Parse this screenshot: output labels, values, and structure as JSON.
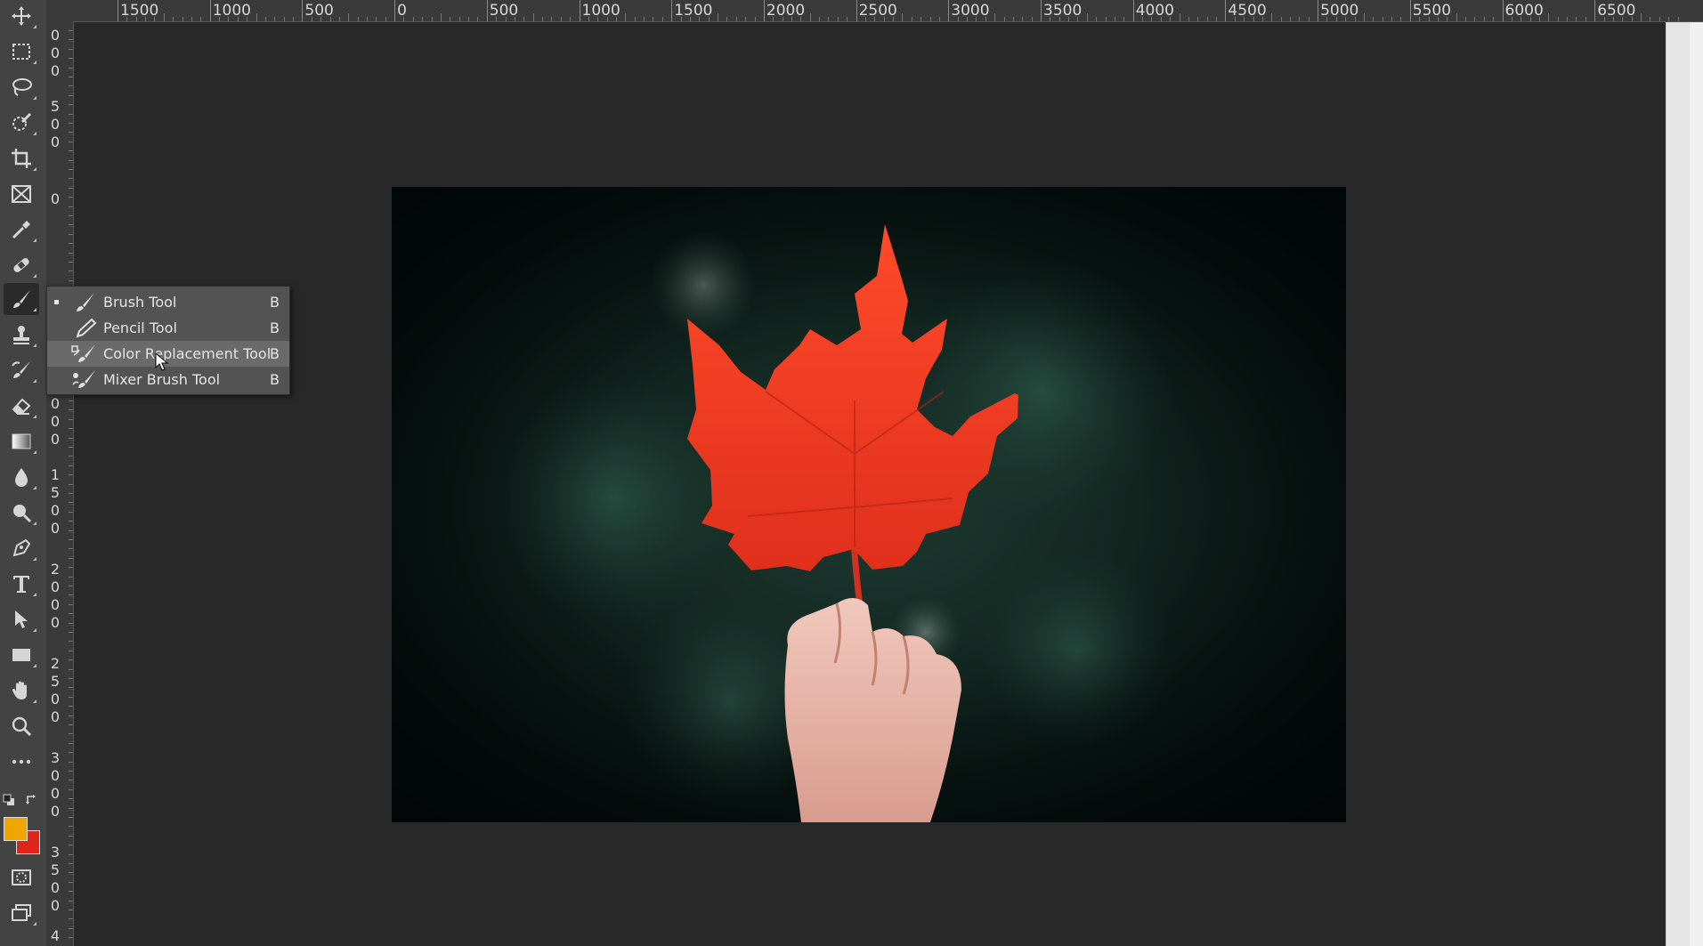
{
  "ruler_top": {
    "labels": [
      "1500",
      "1000",
      "500",
      "0",
      "500",
      "1000",
      "1500",
      "2000",
      "2500",
      "3000",
      "3500",
      "4000",
      "4500",
      "5000",
      "5500",
      "6000",
      "6500"
    ]
  },
  "ruler_left": {
    "labels": [
      "0\n0\n0",
      "5\n0\n0",
      "0",
      "0\n0\n0",
      "1\n5\n0\n0",
      "2\n0\n0\n0",
      "2\n5\n0\n0",
      "3\n0\n0\n0",
      "3\n5\n0\n0",
      "4"
    ]
  },
  "toolbar": {
    "tools": [
      {
        "name": "move-tool",
        "icon": "move-icon"
      },
      {
        "name": "rectangular-marquee-tool",
        "icon": "marquee-icon"
      },
      {
        "name": "lasso-tool",
        "icon": "lasso-icon"
      },
      {
        "name": "quick-selection-tool",
        "icon": "quick-selection-icon"
      },
      {
        "name": "crop-tool",
        "icon": "crop-icon"
      },
      {
        "name": "frame-tool",
        "icon": "frame-icon"
      },
      {
        "name": "eyedropper-tool",
        "icon": "eyedropper-icon"
      },
      {
        "name": "healing-brush-tool",
        "icon": "bandage-icon"
      },
      {
        "name": "brush-tool",
        "icon": "brush-icon",
        "active": true
      },
      {
        "name": "clone-stamp-tool",
        "icon": "stamp-icon"
      },
      {
        "name": "history-brush-tool",
        "icon": "history-brush-icon"
      },
      {
        "name": "eraser-tool",
        "icon": "eraser-icon"
      },
      {
        "name": "gradient-tool",
        "icon": "gradient-icon"
      },
      {
        "name": "blur-tool",
        "icon": "drop-icon"
      },
      {
        "name": "dodge-tool",
        "icon": "dodge-icon"
      },
      {
        "name": "pen-tool",
        "icon": "pen-icon"
      },
      {
        "name": "type-tool",
        "icon": "type-icon"
      },
      {
        "name": "path-selection-tool",
        "icon": "arrow-icon"
      },
      {
        "name": "rectangle-tool",
        "icon": "rectangle-icon"
      },
      {
        "name": "hand-tool",
        "icon": "hand-icon"
      },
      {
        "name": "zoom-tool",
        "icon": "zoom-icon"
      },
      {
        "name": "edit-toolbar",
        "icon": "more-icon"
      }
    ],
    "foreground_color": "#f0a500",
    "background_color": "#e0261a"
  },
  "flyout": {
    "items": [
      {
        "label": "Brush Tool",
        "key": "B",
        "icon": "brush-icon",
        "current": true
      },
      {
        "label": "Pencil Tool",
        "key": "B",
        "icon": "pencil-icon"
      },
      {
        "label": "Color Replacement Tool",
        "key": "B",
        "icon": "color-replacement-icon",
        "hover": true
      },
      {
        "label": "Mixer Brush Tool",
        "key": "B",
        "icon": "mixer-brush-icon"
      }
    ]
  }
}
